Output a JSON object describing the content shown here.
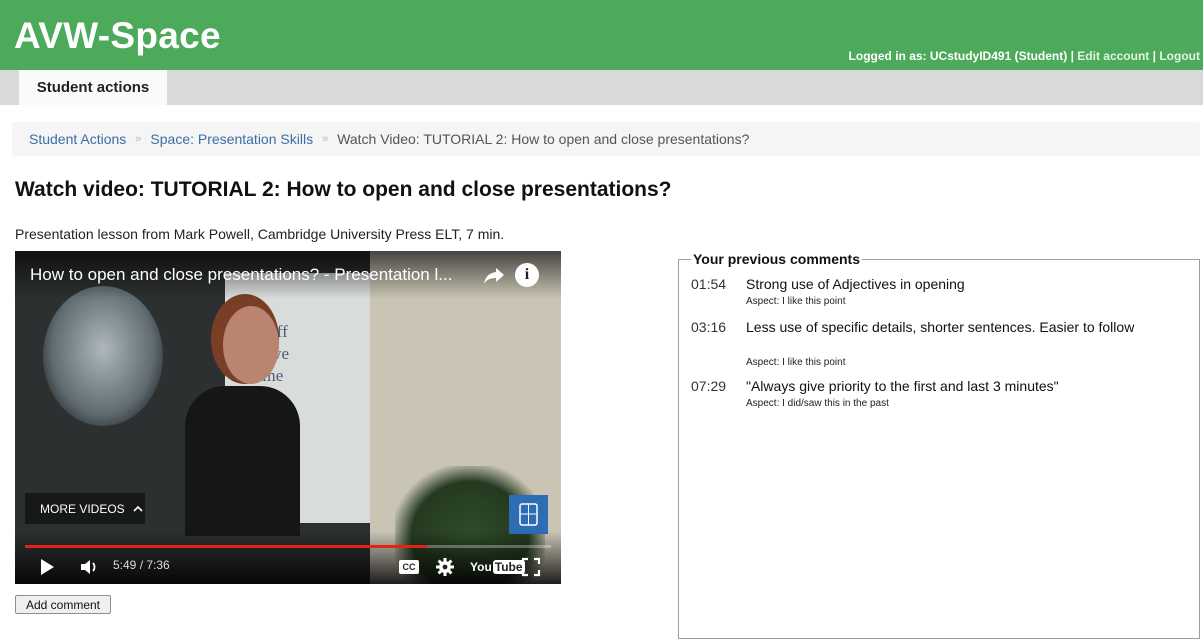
{
  "header": {
    "brand": "AVW-Space",
    "logged_in_text": "Logged in as: UCstudyID491 (Student)",
    "separator": "|",
    "edit_account": "Edit account",
    "logout": "Logout"
  },
  "tabs": {
    "student_actions": "Student actions"
  },
  "breadcrumb": {
    "items": [
      "Student Actions",
      "Space: Presentation Skills",
      "Watch Video: TUTORIAL 2: How to open and close presentations?"
    ],
    "separator": "»"
  },
  "page": {
    "title": "Watch video: TUTORIAL 2: How to open and close presentations?",
    "description": "Presentation lesson from Mark Powell, Cambridge University Press ELT, 7 min."
  },
  "video": {
    "title": "How to open and close presentations? - Presentation l...",
    "board_text": [
      "Staff",
      "ntive",
      "eme"
    ],
    "more_videos": "MORE VIDEOS",
    "time": "5:49 / 7:36",
    "progress": 0.765,
    "cc": "CC",
    "youtube_you": "You",
    "youtube_tube": "Tube"
  },
  "add_comment_label": "Add comment",
  "comments": {
    "legend": "Your previous comments",
    "items": [
      {
        "time": "01:54",
        "text": "Strong use of Adjectives in opening",
        "aspect": "Aspect: I like this point"
      },
      {
        "time": "03:16",
        "text": "Less use of specific details, shorter sentences. Easier to follow",
        "aspect": "Aspect: I like this point"
      },
      {
        "time": "07:29",
        "text": "\"Always give priority to the first and last 3 minutes\"",
        "aspect": "Aspect: I did/saw this in the past"
      }
    ]
  },
  "colors": {
    "header_green": "#4caa5a",
    "link_blue": "#3b6ea5",
    "progress_red": "#e62117"
  }
}
